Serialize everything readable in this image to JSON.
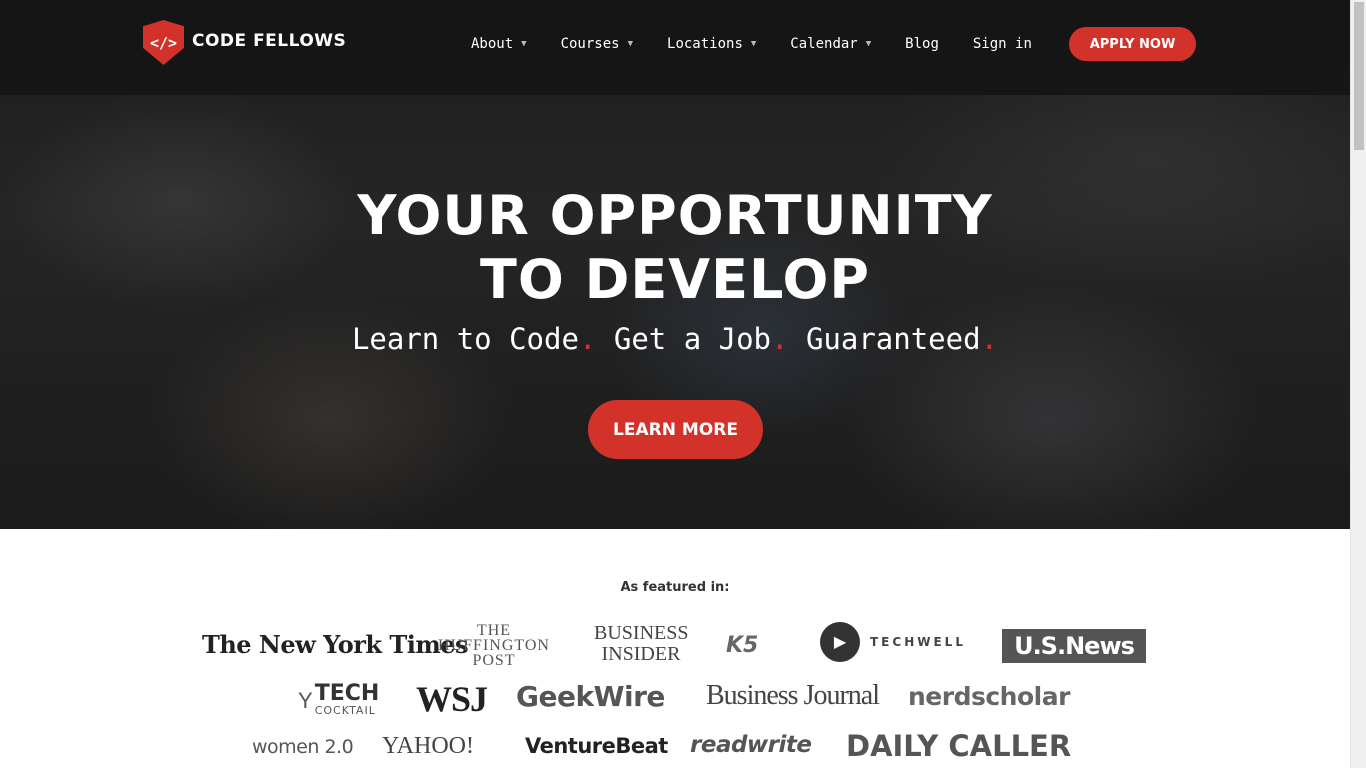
{
  "brand": {
    "logo_glyph": "</>",
    "name": "CODE FELLOWS",
    "accent": "#d3322b"
  },
  "nav": {
    "items": [
      {
        "label": "About",
        "dropdown": true
      },
      {
        "label": "Courses",
        "dropdown": true
      },
      {
        "label": "Locations",
        "dropdown": true
      },
      {
        "label": "Calendar",
        "dropdown": true
      },
      {
        "label": "Blog",
        "dropdown": false
      },
      {
        "label": "Sign in",
        "dropdown": false
      }
    ],
    "apply_label": "APPLY NOW"
  },
  "hero": {
    "headline_line1": "YOUR OPPORTUNITY",
    "headline_line2": "TO DEVELOP",
    "tagline": [
      "Learn to Code",
      "Get a Job",
      "Guaranteed"
    ],
    "tagline_dot": ".",
    "cta_label": "LEARN MORE"
  },
  "featured": {
    "heading": "As featured in:",
    "logos": {
      "nyt": "The New York Times",
      "huffington": "THE HUFFINGTON POST",
      "business_insider": "BUSINESS INSIDER",
      "k5": "K5",
      "techwell": "TECHWELL",
      "usnews": "U.S.News",
      "techcocktail_1": "TECH",
      "techcocktail_2": "COCKTAIL",
      "wsj": "WSJ",
      "geekwire": "GeekWire",
      "business_journal": "Business Journal",
      "nerdscholar": "nerdscholar",
      "women20": "women 2.0",
      "yahoo_finance": "YAHOO!",
      "venturebeat": "VentureBeat",
      "readwrite": "readwrite",
      "daily_caller": "DAILY CALLER"
    }
  }
}
